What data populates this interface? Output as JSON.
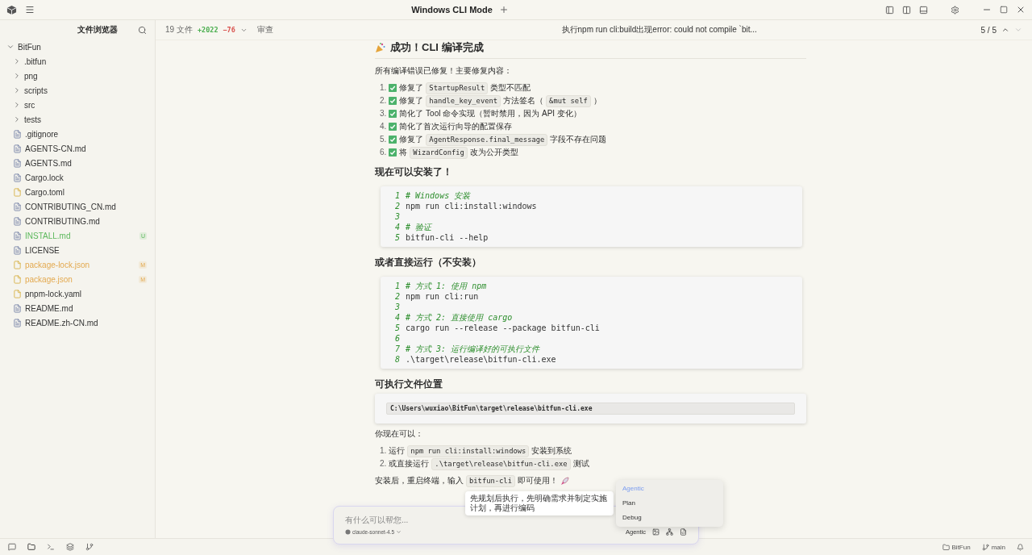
{
  "window": {
    "title": "Windows CLI Mode"
  },
  "sidebar": {
    "title": "文件浏览器",
    "tree": [
      {
        "label": "BitFun",
        "kind": "folder",
        "expanded": true,
        "children": [
          {
            "label": ".bitfun",
            "kind": "folder",
            "expanded": false
          },
          {
            "label": "png",
            "kind": "folder",
            "expanded": false
          },
          {
            "label": "scripts",
            "kind": "folder",
            "expanded": false
          },
          {
            "label": "src",
            "kind": "folder",
            "expanded": false
          },
          {
            "label": "tests",
            "kind": "folder",
            "expanded": false
          },
          {
            "label": ".gitignore",
            "kind": "doc"
          },
          {
            "label": "AGENTS-CN.md",
            "kind": "doc"
          },
          {
            "label": "AGENTS.md",
            "kind": "doc"
          },
          {
            "label": "Cargo.lock",
            "kind": "doc"
          },
          {
            "label": "Cargo.toml",
            "kind": "file"
          },
          {
            "label": "CONTRIBUTING_CN.md",
            "kind": "doc"
          },
          {
            "label": "CONTRIBUTING.md",
            "kind": "doc"
          },
          {
            "label": "INSTALL.md",
            "kind": "doc",
            "untracked": true,
            "badge": "U"
          },
          {
            "label": "LICENSE",
            "kind": "doc"
          },
          {
            "label": "package-lock.json",
            "kind": "file",
            "modified": true,
            "badge": "M"
          },
          {
            "label": "package.json",
            "kind": "file",
            "modified": true,
            "badge": "M"
          },
          {
            "label": "pnpm-lock.yaml",
            "kind": "file"
          },
          {
            "label": "README.md",
            "kind": "doc"
          },
          {
            "label": "README.zh-CN.md",
            "kind": "doc"
          }
        ]
      }
    ]
  },
  "changes": {
    "files": "19 文件",
    "added": "+2022",
    "removed": "−76",
    "review": "审查"
  },
  "conversation": {
    "title": "执行npm run cli:build出现error: could not compile `bit...",
    "position": "5 / 5"
  },
  "content": [
    {
      "kind": "h1",
      "text": "成功！CLI 编译完成"
    },
    {
      "kind": "p",
      "segments": [
        {
          "kind": "text",
          "text": "所有编译错误已修复！主要修复内容："
        }
      ]
    },
    {
      "kind": "ol",
      "items": [
        {
          "n": "1.",
          "checked": true,
          "segments": [
            {
              "kind": "text",
              "text": "修复了"
            },
            {
              "kind": "code",
              "text": "StartupResult"
            },
            {
              "kind": "text",
              "text": "类型不匹配"
            }
          ]
        },
        {
          "n": "2.",
          "checked": true,
          "segments": [
            {
              "kind": "text",
              "text": "修复了"
            },
            {
              "kind": "code",
              "text": "handle_key_event"
            },
            {
              "kind": "text",
              "text": "方法签名（"
            },
            {
              "kind": "code",
              "text": "&mut self"
            },
            {
              "kind": "text",
              "text": "）"
            }
          ]
        },
        {
          "n": "3.",
          "checked": true,
          "segments": [
            {
              "kind": "text",
              "text": "简化了 Tool 命令实现（暂时禁用，因为 API 变化）"
            }
          ]
        },
        {
          "n": "4.",
          "checked": true,
          "segments": [
            {
              "kind": "text",
              "text": "简化了首次运行向导的配置保存"
            }
          ]
        },
        {
          "n": "5.",
          "checked": true,
          "segments": [
            {
              "kind": "text",
              "text": "修复了"
            },
            {
              "kind": "code",
              "text": "AgentResponse.final_message"
            },
            {
              "kind": "text",
              "text": "字段不存在问题"
            }
          ]
        },
        {
          "n": "6.",
          "checked": true,
          "segments": [
            {
              "kind": "text",
              "text": "将"
            },
            {
              "kind": "code",
              "text": "WizardConfig"
            },
            {
              "kind": "text",
              "text": "改为公开类型"
            }
          ]
        }
      ]
    },
    {
      "kind": "h2",
      "text": "现在可以安装了！"
    },
    {
      "kind": "codeblock",
      "lines": [
        {
          "n": "1",
          "kind": "comment",
          "text": "# Windows 安装"
        },
        {
          "n": "2",
          "kind": "code",
          "text": "npm run cli:install:windows"
        },
        {
          "n": "3",
          "kind": "blank"
        },
        {
          "n": "4",
          "kind": "comment",
          "text": "# 验证"
        },
        {
          "n": "5",
          "kind": "code",
          "text": "bitfun-cli --help"
        }
      ]
    },
    {
      "kind": "h2",
      "text": "或者直接运行（不安装）"
    },
    {
      "kind": "codeblock",
      "lines": [
        {
          "n": "1",
          "kind": "comment",
          "text": "# 方式 1: 使用 npm"
        },
        {
          "n": "2",
          "kind": "code",
          "text": "npm run cli:run"
        },
        {
          "n": "3",
          "kind": "blank"
        },
        {
          "n": "4",
          "kind": "comment",
          "text": "# 方式 2: 直接使用 cargo"
        },
        {
          "n": "5",
          "kind": "code",
          "text": "cargo run --release --package bitfun-cli"
        },
        {
          "n": "6",
          "kind": "blank"
        },
        {
          "n": "7",
          "kind": "comment",
          "text": "# 方式 3: 运行编译好的可执行文件"
        },
        {
          "n": "8",
          "kind": "code",
          "text": ".\\target\\release\\bitfun-cli.exe"
        }
      ]
    },
    {
      "kind": "h2",
      "text": "可执行文件位置"
    },
    {
      "kind": "pathblock",
      "text": "C:\\Users\\wuxiao\\BitFun\\target\\release\\bitfun-cli.exe"
    },
    {
      "kind": "p",
      "segments": [
        {
          "kind": "text",
          "text": "你现在可以："
        }
      ]
    },
    {
      "kind": "ol",
      "items": [
        {
          "n": "1.",
          "segments": [
            {
              "kind": "text",
              "text": "运行"
            },
            {
              "kind": "code",
              "text": "npm run cli:install:windows"
            },
            {
              "kind": "text",
              "text": "安装到系统"
            }
          ]
        },
        {
          "n": "2.",
          "segments": [
            {
              "kind": "text",
              "text": "或直接运行"
            },
            {
              "kind": "code",
              "text": ".\\target\\release\\bitfun-cli.exe"
            },
            {
              "kind": "text",
              "text": "测试"
            }
          ]
        }
      ]
    },
    {
      "kind": "p",
      "rocket": true,
      "segments": [
        {
          "kind": "text",
          "text": "安装后，重启终端，输入"
        },
        {
          "kind": "code",
          "text": "bitfun-cli"
        },
        {
          "kind": "text",
          "text": "即可使用！"
        }
      ]
    }
  ],
  "composer": {
    "placeholder": "有什么可以帮您...",
    "model": "claude-sonnet-4.5",
    "mode": "Agentic"
  },
  "tooltip": "先规划后执行，先明确需求并制定实施计划，再进行编码",
  "mode_menu": [
    {
      "label": "Agentic",
      "selected": true
    },
    {
      "label": "Plan",
      "selected": false
    },
    {
      "label": "Debug",
      "selected": false
    }
  ],
  "status_bar": {
    "workspace": "BitFun",
    "branch": "main"
  }
}
